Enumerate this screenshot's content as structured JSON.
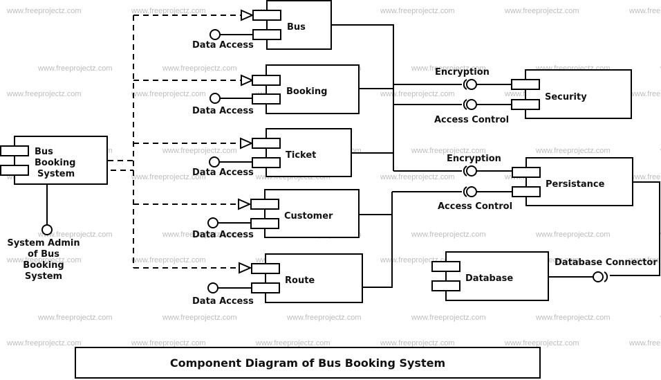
{
  "watermark": "www.freeprojectz.com",
  "title": "Component Diagram of Bus Booking System",
  "main_component": {
    "name_lines": [
      "Bus",
      "Booking",
      "System"
    ]
  },
  "admin_interface": {
    "label_lines": [
      "System Admin",
      "of Bus",
      "Booking",
      "System"
    ]
  },
  "components": [
    {
      "id": "bus",
      "name": "Bus",
      "interface": "Data Access"
    },
    {
      "id": "booking",
      "name": "Booking",
      "interface": "Data Access"
    },
    {
      "id": "ticket",
      "name": "Ticket",
      "interface": "Data Access"
    },
    {
      "id": "customer",
      "name": "Customer",
      "interface": "Data Access"
    },
    {
      "id": "route",
      "name": "Route",
      "interface": "Data Access"
    }
  ],
  "security": {
    "name": "Security",
    "interfaces": [
      "Encryption",
      "Access Control"
    ]
  },
  "persistance": {
    "name": "Persistance",
    "interfaces": [
      "Encryption",
      "Access Control"
    ]
  },
  "database": {
    "name": "Database",
    "interface": "Database Connector"
  }
}
